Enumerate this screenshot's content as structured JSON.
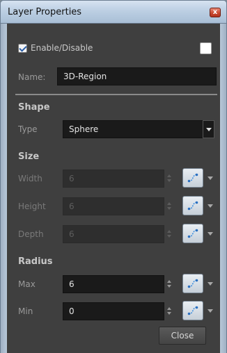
{
  "window": {
    "title": "Layer Properties",
    "close_glyph": "x"
  },
  "enable": {
    "label": "Enable/Disable",
    "checked": true,
    "swatch_color": "#ffffff"
  },
  "name": {
    "label": "Name:",
    "value": "3D-Region"
  },
  "shape": {
    "section_label": "Shape",
    "type_label": "Type",
    "type_value": "Sphere"
  },
  "size": {
    "section_label": "Size",
    "width": {
      "label": "Width",
      "value": "6",
      "enabled": false
    },
    "height": {
      "label": "Height",
      "value": "6",
      "enabled": false
    },
    "depth": {
      "label": "Depth",
      "value": "6",
      "enabled": false
    }
  },
  "radius": {
    "section_label": "Radius",
    "max": {
      "label": "Max",
      "value": "6",
      "enabled": true
    },
    "min": {
      "label": "Min",
      "value": "0",
      "enabled": true
    }
  },
  "close_button": {
    "label": "Close"
  },
  "icons": {
    "function": "function-curve-icon",
    "spinner": "spinner-icon",
    "dropdown": "chevron-down-icon"
  },
  "colors": {
    "panel_bg": "#3f3f3f",
    "field_bg": "#1a1a1a",
    "accent": "#2c7fd6"
  }
}
